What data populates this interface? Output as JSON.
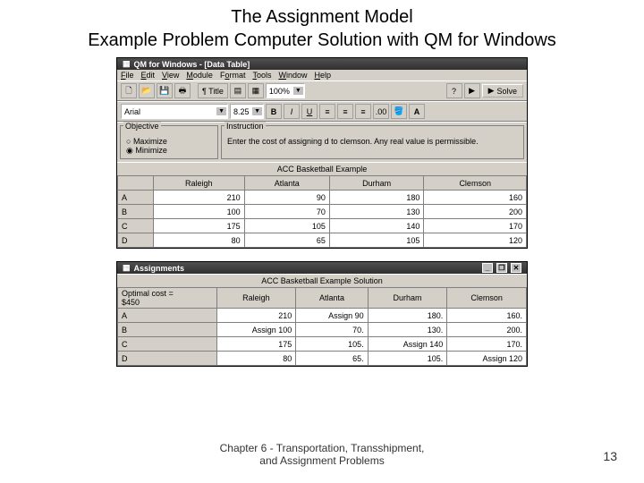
{
  "slide": {
    "title_l1": "The Assignment Model",
    "title_l2": "Example Problem Computer Solution with QM for Windows",
    "footer": "Chapter 6 - Transportation, Transshipment,\nand Assignment Problems",
    "page": "13"
  },
  "win1": {
    "title": "QM for Windows - [Data Table]",
    "menu": [
      "File",
      "Edit",
      "View",
      "Module",
      "Format",
      "Tools",
      "Window",
      "Help"
    ],
    "font": "Arial",
    "size": "8.25",
    "zoom": "100%",
    "solve": "Solve",
    "objective": {
      "label": "Objective",
      "opt1": "Maximize",
      "opt2": "Minimize"
    },
    "instruction": {
      "label": "Instruction",
      "text": "Enter the cost of assigning d to clemson. Any real value is permissible."
    },
    "caption": "ACC Basketball Example",
    "cols": [
      "",
      "Raleigh",
      "Atlanta",
      "Durham",
      "Clemson"
    ],
    "rows": [
      {
        "h": "A",
        "v": [
          "210",
          "90",
          "180",
          "160"
        ]
      },
      {
        "h": "B",
        "v": [
          "100",
          "70",
          "130",
          "200"
        ]
      },
      {
        "h": "C",
        "v": [
          "175",
          "105",
          "140",
          "170"
        ]
      },
      {
        "h": "D",
        "v": [
          "80",
          "65",
          "105",
          "120"
        ]
      }
    ]
  },
  "win2": {
    "title": "Assignments",
    "caption": "ACC Basketball Example Solution",
    "optlabel": "Optimal cost =",
    "optval": "$450",
    "cols": [
      "",
      "Raleigh",
      "Atlanta",
      "Durham",
      "Clemson"
    ],
    "rows": [
      {
        "h": "A",
        "v": [
          "210",
          "Assign 90",
          "180.",
          "160."
        ]
      },
      {
        "h": "B",
        "v": [
          "Assign 100",
          "70.",
          "130.",
          "200."
        ]
      },
      {
        "h": "C",
        "v": [
          "175",
          "105.",
          "Assign 140",
          "170."
        ]
      },
      {
        "h": "D",
        "v": [
          "80",
          "65.",
          "105.",
          "Assign 120"
        ]
      }
    ]
  }
}
